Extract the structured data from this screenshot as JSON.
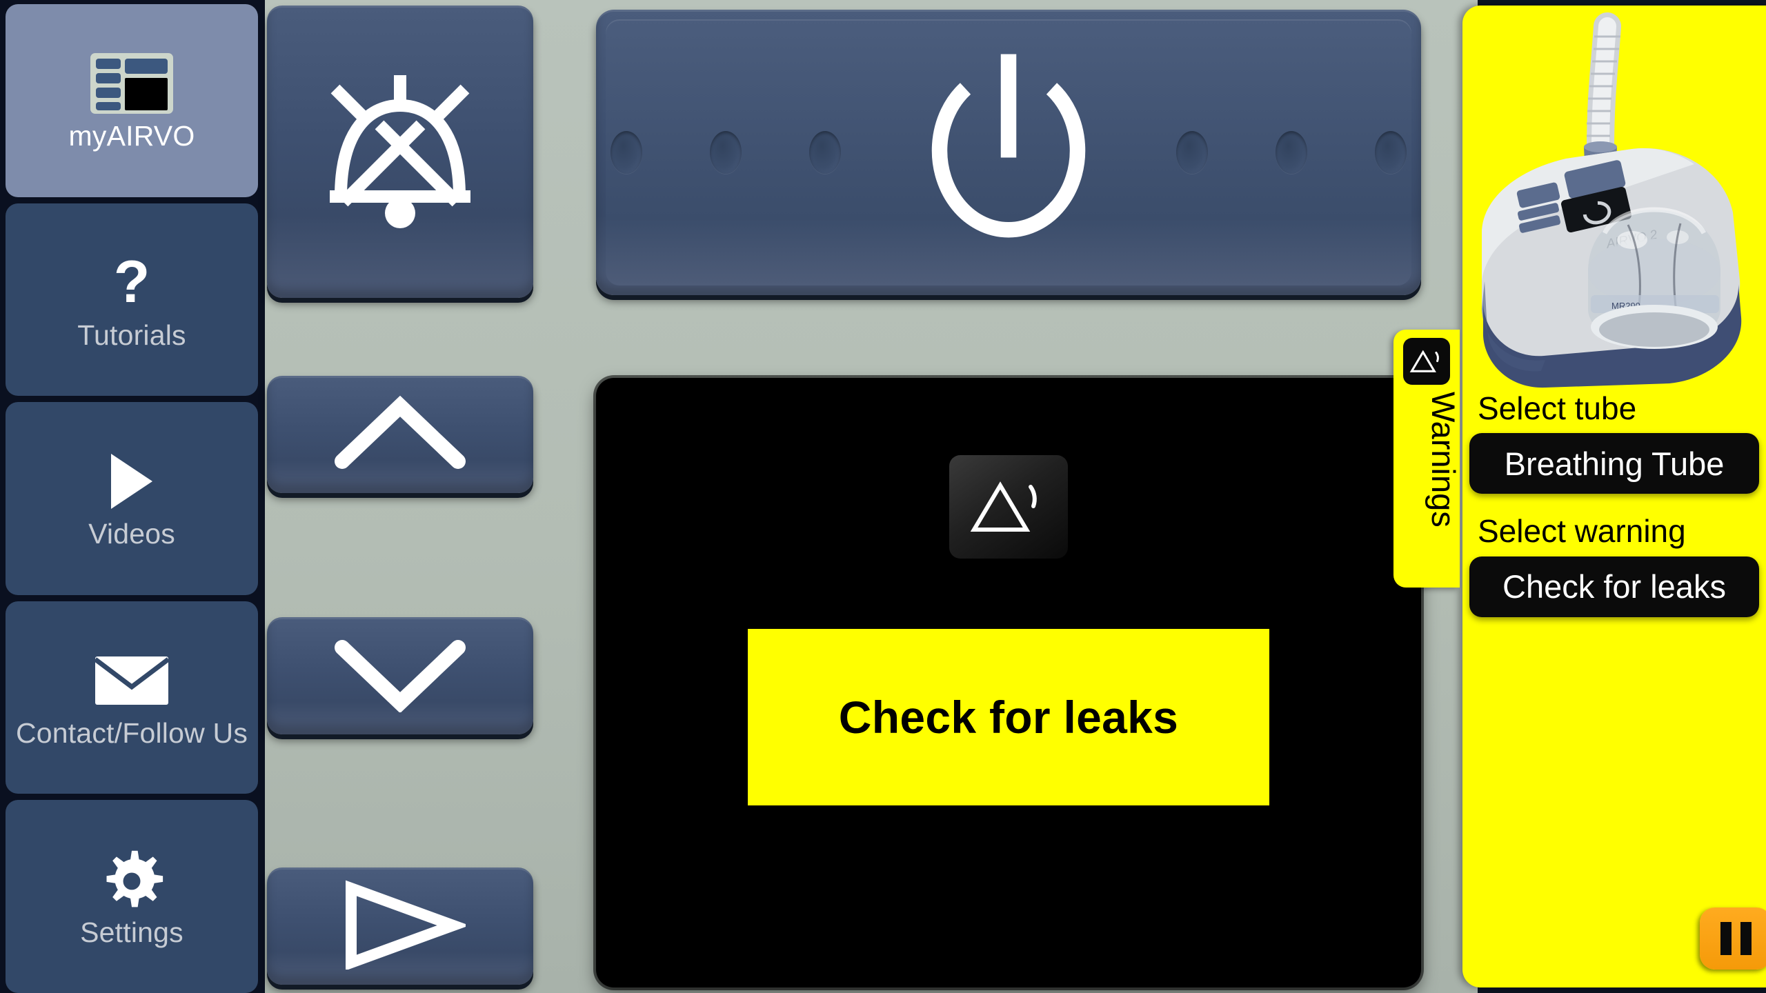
{
  "app": {
    "name": "myAIRVO",
    "background_color": "#b5bfb7",
    "accent_warning_color": "#ffff00",
    "panel_dark_color": "#324868",
    "pause_color": "#f59a09"
  },
  "sidebar": {
    "items": [
      {
        "label": "myAIRVO",
        "icon": "layout-grid-icon",
        "active": true
      },
      {
        "label": "Tutorials",
        "icon": "question-mark-icon",
        "active": false
      },
      {
        "label": "Videos",
        "icon": "play-icon",
        "active": false
      },
      {
        "label": "Contact/Follow Us",
        "icon": "envelope-icon",
        "active": false
      },
      {
        "label": "Settings",
        "icon": "gear-icon",
        "active": false
      }
    ]
  },
  "device": {
    "buttons": [
      {
        "name": "alarm-mute",
        "icon": "bell-crossed-icon"
      },
      {
        "name": "up",
        "icon": "chevron-up-icon"
      },
      {
        "name": "down",
        "icon": "chevron-down-icon"
      },
      {
        "name": "mode",
        "icon": "play-outline-icon"
      },
      {
        "name": "power",
        "icon": "power-icon"
      }
    ],
    "screen": {
      "warning_icon": "warning-triangle-sound-icon",
      "banner_text": "Check for leaks",
      "banner_color": "#ffff00",
      "background_color": "#000000"
    }
  },
  "warnings_panel": {
    "tab_label": "Warnings",
    "tab_icon": "warning-triangle-sound-icon",
    "photo_caption": "AIRVO 2",
    "select_tube_label": "Select tube",
    "selected_tube": "Breathing Tube",
    "select_warning_label": "Select warning",
    "selected_warning": "Check for leaks",
    "pause_button": "pause-icon"
  }
}
